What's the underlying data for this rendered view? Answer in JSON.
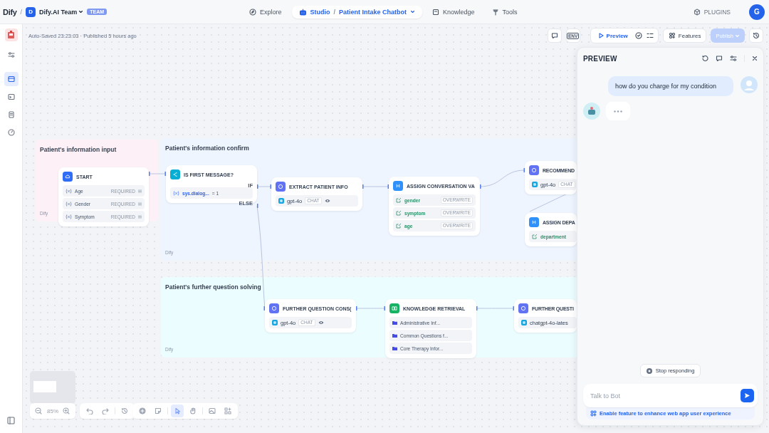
{
  "topbar": {
    "logo": "Dify",
    "logo_separator": "/",
    "workspace": {
      "initial": "D",
      "name": "Dify.AI Team",
      "badge": "TEAM"
    },
    "nav": [
      {
        "label": "Explore",
        "selected": false
      },
      {
        "label": "Studio",
        "selected": true,
        "separator": "/",
        "app": "Patient Intake Chatbot"
      },
      {
        "label": "Knowledge",
        "selected": false
      },
      {
        "label": "Tools",
        "selected": false
      }
    ],
    "plugins": "PLUGINS",
    "user_initial": "G"
  },
  "rail": {
    "items": [
      {
        "selected": false
      },
      {
        "selected": true
      },
      {
        "selected": false
      },
      {
        "selected": false
      },
      {
        "selected": false
      }
    ]
  },
  "header": {
    "status": "Auto-Saved 23:23:03 · Published 5 hours ago",
    "env": "ENV",
    "preview": "Preview",
    "features": "Features",
    "publish": {
      "label": "Publish",
      "disabled": true
    }
  },
  "groups": [
    {
      "title": "Patient's information input",
      "footer": "Dify",
      "color": "#fdf1f7"
    },
    {
      "title": "Patient's information confirm",
      "footer": "Dify",
      "color": "#eef5ff"
    },
    {
      "title": "Patient's further question solving",
      "footer": "Dify",
      "color": "#ecfdff"
    }
  ],
  "nodes": [
    {
      "kind": "start",
      "title": "START",
      "rows": [
        {
          "name": "Age",
          "tag": "REQUIRED"
        },
        {
          "name": "Gender",
          "tag": "REQUIRED"
        },
        {
          "name": "Symptom",
          "tag": "REQUIRED"
        }
      ]
    },
    {
      "kind": "if",
      "title": "IS FIRST MESSAGE?",
      "condition": {
        "variable": "sys.dialog...",
        "value": "= 1"
      },
      "branches": [
        "IF",
        "ELSE"
      ]
    },
    {
      "kind": "llm",
      "title": "EXTRACT PATIENT INFO",
      "model": "gpt-4o",
      "mode": "CHAT",
      "vision": true
    },
    {
      "kind": "assign",
      "title": "ASSIGN CONVERSATION VA",
      "rows": [
        {
          "name": "gender",
          "tag": "OVERWRITE"
        },
        {
          "name": "symptom",
          "tag": "OVERWRITE"
        },
        {
          "name": "age",
          "tag": "OVERWRITE"
        }
      ]
    },
    {
      "kind": "llm",
      "title": "RECOMMEND",
      "model": "gpt-4o",
      "mode": "CHAT"
    },
    {
      "kind": "assign",
      "title": "ASSIGN DEPA",
      "rows": [
        {
          "name": "department"
        }
      ]
    },
    {
      "kind": "llm",
      "title": "FURTHER QUESTION CONS(",
      "model": "gpt-4o",
      "mode": "CHAT",
      "vision": true
    },
    {
      "kind": "knowledge",
      "title": "KNOWLEDGE RETRIEVAL",
      "rows": [
        {
          "name": "Administrative Inf..."
        },
        {
          "name": "Common Questions f..."
        },
        {
          "name": "Core Therapy Infor..."
        }
      ]
    },
    {
      "kind": "llm",
      "title": "FURTHER QUESTI",
      "model": "chatgpt-4o-lates"
    }
  ],
  "toolbar": {
    "zoom": "85%",
    "tools": [
      {
        "selected": false
      },
      {
        "selected": false
      },
      {
        "selected": true
      },
      {
        "selected": false
      },
      {
        "selected": false
      },
      {
        "selected": false
      }
    ]
  },
  "preview": {
    "title": "PREVIEW",
    "messages": [
      {
        "kind": "user",
        "text": "how do you charge for my condition"
      },
      {
        "kind": "bot",
        "typing": true
      }
    ],
    "stop_button": "Stop responding",
    "input": {
      "placeholder": "Talk to Bot"
    },
    "feature_hint": "Enable feature to enhance web app user experience"
  }
}
